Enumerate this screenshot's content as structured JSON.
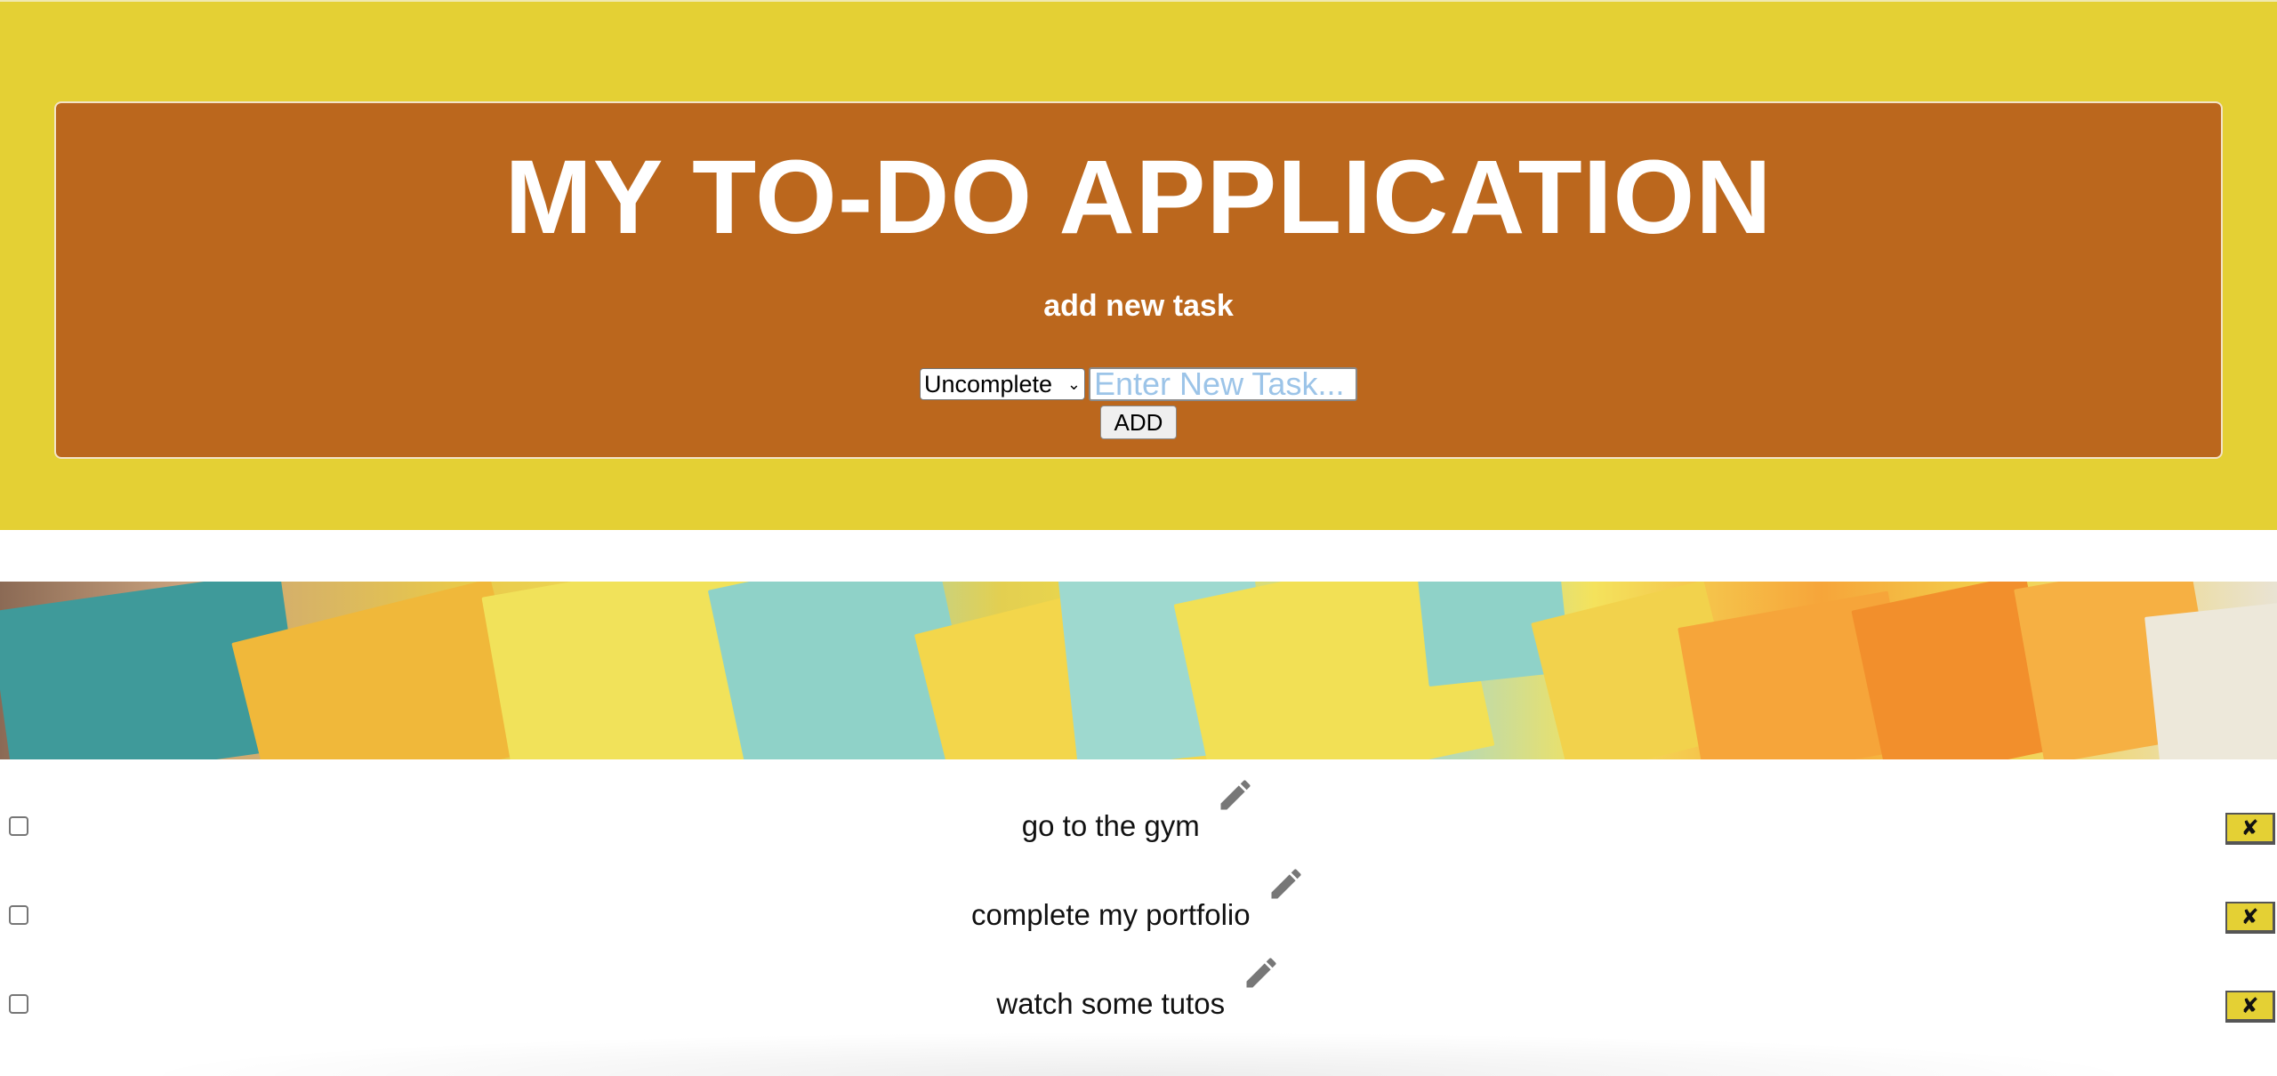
{
  "app": {
    "title": "MY TO-DO APPLICATION",
    "add_heading": "add new task"
  },
  "form": {
    "status_select_value": "Uncomplete",
    "task_input_placeholder": "Enter New Task...",
    "task_input_value": "",
    "add_button_label": "ADD"
  },
  "tasks": [
    {
      "text": "go to the gym",
      "completed": false,
      "delete_label": "✘",
      "edit_icon": "pencil-icon"
    },
    {
      "text": "complete my portfolio",
      "completed": false,
      "delete_label": "✘",
      "edit_icon": "pencil-icon"
    },
    {
      "text": "watch some tutos",
      "completed": false,
      "delete_label": "✘",
      "edit_icon": "pencil-icon"
    }
  ],
  "banner": {
    "description_icon": "sticky-notes-image"
  },
  "colors": {
    "header_band": "#e4d034",
    "panel": "#bb671d",
    "delete_button": "#e4d034",
    "placeholder": "#9cc4e8"
  }
}
